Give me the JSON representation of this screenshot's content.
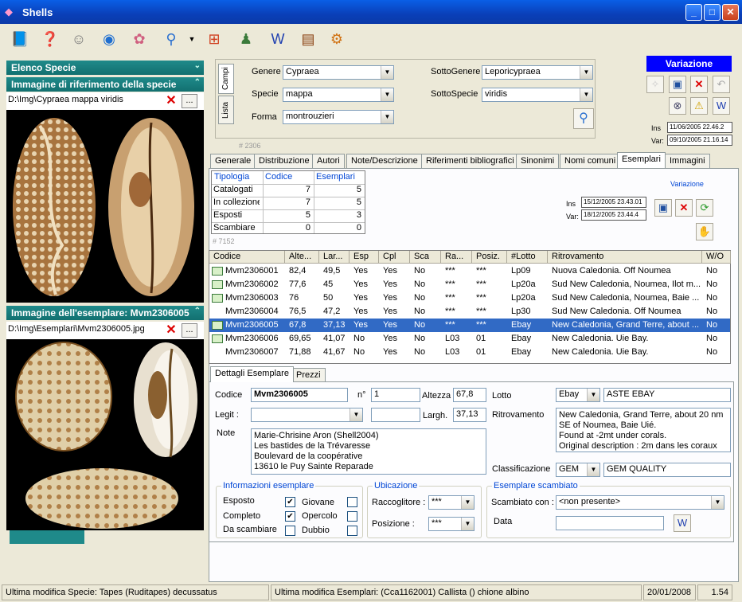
{
  "window": {
    "title": "Shells",
    "min": "_",
    "max": "□",
    "close": "✕"
  },
  "toolbar": {
    "icons": [
      "book-icon",
      "help-icon",
      "person-icon",
      "globe-icon",
      "shell-icon",
      "search-icon",
      "windows-icon",
      "users-icon",
      "word-icon",
      "books-icon",
      "gear-icon"
    ]
  },
  "left": {
    "species_list_header": "Elenco Specie",
    "ref_image_header": "Immagine di riferimento della specie",
    "ref_image_path": "D:\\Img\\Cypraea mappa viridis",
    "specimen_image_header": "Immagine dell'esemplare: Mvm2306005",
    "specimen_image_path": "D:\\Img\\Esemplari\\Mvm2306005.jpg",
    "dots": "..."
  },
  "species": {
    "side_tabs": [
      "Campi",
      "Lista"
    ],
    "genere_label": "Genere",
    "genere": "Cypraea",
    "sottogenere_label": "SottoGenere",
    "sottogenere": "Leporicypraea",
    "specie_label": "Specie",
    "specie": "mappa",
    "sottospecie_label": "SottoSpecie",
    "sottospecie": "viridis",
    "forma_label": "Forma",
    "forma": "montrouzieri",
    "record_no": "# 2306"
  },
  "variazione": {
    "banner": "Variazione",
    "ins_label": "Ins",
    "ins": "11/06/2005 22.46.2",
    "var_label": "Var:",
    "var": "09/10/2005 21.16.14"
  },
  "tabs": [
    "Generale",
    "Distribuzione",
    "Autori",
    "Note/Descrizione",
    "Riferimenti bibliografici",
    "Sinonimi",
    "Nomi comuni",
    "Esemplari",
    "Immagini"
  ],
  "active_tab": "Esemplari",
  "summary": {
    "headers": [
      "Tipologia",
      "Codice",
      "Esemplari"
    ],
    "rows": [
      [
        "Catalogati",
        "7",
        "5"
      ],
      [
        "In collezione",
        "7",
        "5"
      ],
      [
        "Esposti",
        "5",
        "3"
      ],
      [
        "Scambiare",
        "0",
        "0"
      ]
    ],
    "record_no": "# 7152"
  },
  "esemplari_var": {
    "title": "Variazione",
    "ins_label": "Ins",
    "ins": "15/12/2005 23.43.01",
    "var_label": "Var:",
    "var": "18/12/2005 23.44.4"
  },
  "specimens": {
    "headers": [
      "Codice",
      "Alte...",
      "Lar...",
      "Esp",
      "Cpl",
      "Sca",
      "Ra...",
      "Posiz.",
      "#Lotto",
      "Ritrovamento",
      "W/O"
    ],
    "rows": [
      [
        "Mvm2306001",
        "82,4",
        "49,5",
        "Yes",
        "Yes",
        "No",
        "***",
        "***",
        "Lp09",
        "Nuova Caledonia. Off Noumea",
        "No"
      ],
      [
        "Mvm2306002",
        "77,6",
        "45",
        "Yes",
        "Yes",
        "No",
        "***",
        "***",
        "Lp20a",
        "Sud New Caledonia, Noumea, Ilot m...",
        "No"
      ],
      [
        "Mvm2306003",
        "76",
        "50",
        "Yes",
        "Yes",
        "No",
        "***",
        "***",
        "Lp20a",
        "Sud New Caledonia, Noumea, Baie ...",
        "No"
      ],
      [
        "Mvm2306004",
        "76,5",
        "47,2",
        "Yes",
        "Yes",
        "No",
        "***",
        "***",
        "Lp30",
        "Sud New Caledonia. Off Noumea",
        "No"
      ],
      [
        "Mvm2306005",
        "67,8",
        "37,13",
        "Yes",
        "Yes",
        "No",
        "***",
        "***",
        "Ebay",
        "New Caledonia, Grand Terre, about ...",
        "No"
      ],
      [
        "Mvm2306006",
        "69,65",
        "41,07",
        "No",
        "Yes",
        "No",
        "L03",
        "01",
        "Ebay",
        "New Caledonia. Uie Bay.",
        "No"
      ],
      [
        "Mvm2306007",
        "71,88",
        "41,67",
        "No",
        "Yes",
        "No",
        "L03",
        "01",
        "Ebay",
        "New Caledonia. Uie Bay.",
        "No"
      ]
    ],
    "selected": 4
  },
  "detail": {
    "tabs": [
      "Dettagli Esemplare",
      "Prezzi"
    ],
    "codice_label": "Codice",
    "codice": "Mvm2306005",
    "n_label": "n°",
    "n": "1",
    "altezza_label": "Altezza",
    "altezza": "67,8",
    "legit_label": "Legit :",
    "legit": "",
    "largh_label": "Largh.",
    "largh": "37,13",
    "note_label": "Note",
    "note": [
      "Marie-Chrisine Aron (Shell2004)",
      "Les bastides de la Trévaresse",
      "Boulevard de la coopérative",
      "13610 le Puy Sainte Reparade"
    ],
    "lotto_label": "Lotto",
    "lotto": "Ebay",
    "lotto_desc": "ASTE EBAY",
    "ritrovamento_label": "Ritrovamento",
    "ritrovamento": [
      "New Caledonia, Grand Terre, about 20 nm",
      "SE of Noumea, Baie Uié.",
      "Found at -2mt under corals.",
      "Original description : 2m dans les coraux"
    ],
    "classificazione_label": "Classificazione",
    "classificazione": "GEM",
    "classificazione_desc": "GEM QUALITY"
  },
  "info": {
    "legend": "Informazioni esemplare",
    "esposto": "Esposto",
    "completo": "Completo",
    "da_scambiare": "Da scambiare",
    "giovane": "Giovane",
    "opercolo": "Opercolo",
    "dubbio": "Dubbio",
    "esposto_checked": true,
    "completo_checked": true,
    "scambiare_checked": false,
    "giovane_checked": false,
    "opercolo_checked": false,
    "dubbio_checked": false
  },
  "ubicazione": {
    "legend": "Ubicazione",
    "raccoglitore_label": "Raccoglitore :",
    "raccoglitore": "***",
    "posizione_label": "Posizione :",
    "posizione": "***"
  },
  "scambiato": {
    "legend": "Esemplare scambiato",
    "con_label": "Scambiato con :",
    "con": "<non presente>",
    "data_label": "Data",
    "data": ""
  },
  "status": {
    "species": "Ultima modifica Specie: Tapes (Ruditapes) decussatus",
    "esemplari": "Ultima modifica Esemplari: (Cca1162001) Callista () chione  albino",
    "date": "20/01/2008",
    "version": "1.54"
  }
}
